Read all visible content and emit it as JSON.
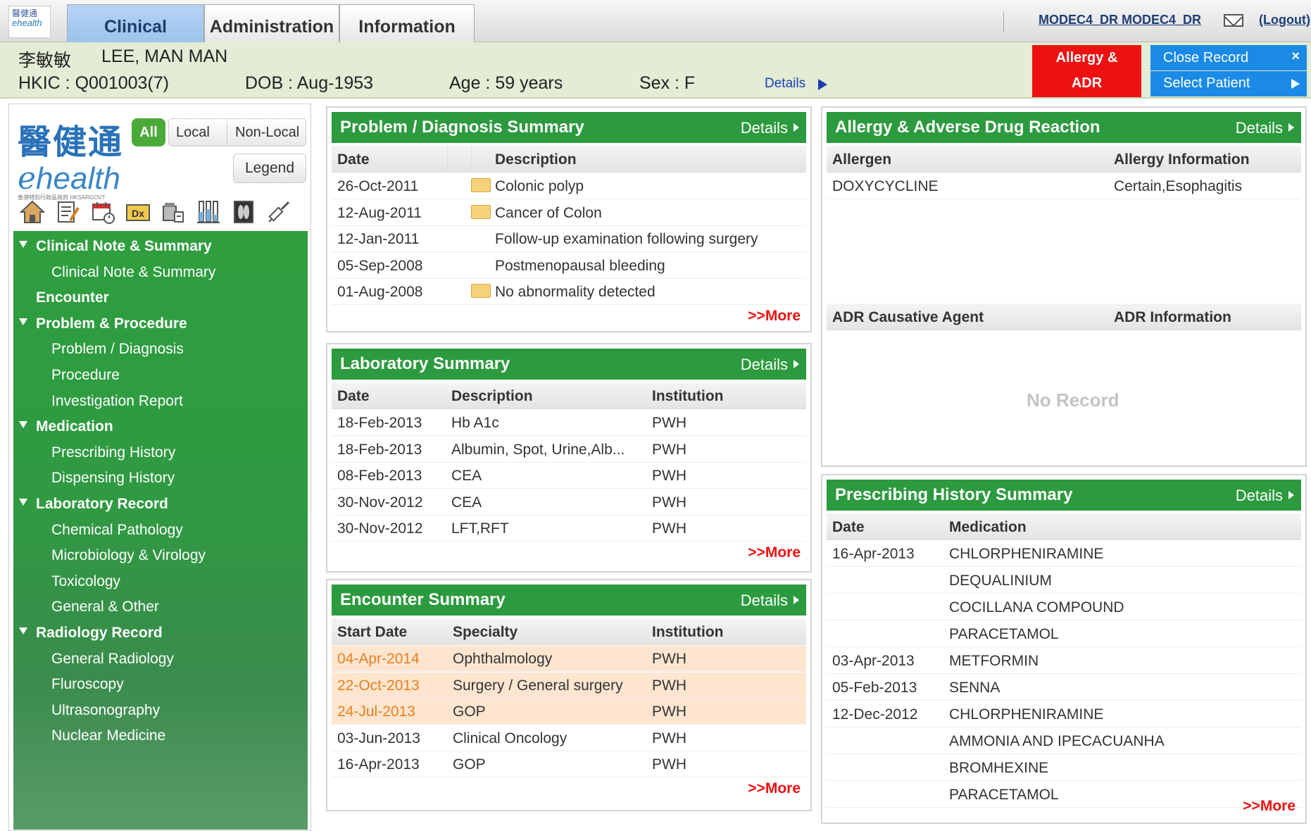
{
  "top": {
    "logo_lines": [
      "醫健通",
      "ehealth"
    ],
    "tabs": [
      "Clinical",
      "Administration",
      "Information"
    ],
    "user": "MODEC4_DR MODEC4_DR",
    "logout": "(Logout)"
  },
  "patient": {
    "chinese_name": "李敏敏",
    "english_name": "LEE, MAN MAN",
    "hkic": "HKIC : Q001003(7)",
    "dob": "DOB : Aug-1953",
    "age": "Age : 59 years",
    "sex": "Sex : F",
    "details": "Details",
    "allergy_btn": [
      "Allergy &",
      "ADR"
    ],
    "close_record": "Close Record",
    "close_x": "×",
    "select_patient": "Select Patient"
  },
  "leftnav": {
    "logo_cn": "醫健通",
    "logo_en": "health",
    "logo_e": "e",
    "logo_sub": "香港特別行政區政府 HKSARGOVT",
    "filters": {
      "all": "All",
      "local": "Local",
      "nonlocal": "Non-Local"
    },
    "legend": "Legend",
    "tree": [
      {
        "label": "Clinical Note & Summary",
        "parent": true,
        "expanded": true
      },
      {
        "label": "Clinical Note & Summary",
        "parent": false
      },
      {
        "label": "Encounter",
        "parent": true,
        "expanded": false
      },
      {
        "label": "Problem & Procedure",
        "parent": true,
        "expanded": true
      },
      {
        "label": "Problem / Diagnosis",
        "parent": false
      },
      {
        "label": "Procedure",
        "parent": false
      },
      {
        "label": "Investigation Report",
        "parent": false
      },
      {
        "label": "Medication",
        "parent": true,
        "expanded": true
      },
      {
        "label": "Prescribing History",
        "parent": false
      },
      {
        "label": "Dispensing History",
        "parent": false
      },
      {
        "label": "Laboratory Record",
        "parent": true,
        "expanded": true
      },
      {
        "label": "Chemical Pathology",
        "parent": false
      },
      {
        "label": "Microbiology & Virology",
        "parent": false
      },
      {
        "label": "Toxicology",
        "parent": false
      },
      {
        "label": "General & Other",
        "parent": false
      },
      {
        "label": "Radiology Record",
        "parent": true,
        "expanded": true
      },
      {
        "label": "General Radiology",
        "parent": false
      },
      {
        "label": "Fluroscopy",
        "parent": false
      },
      {
        "label": "Ultrasonography",
        "parent": false
      },
      {
        "label": "Nuclear Medicine",
        "parent": false
      }
    ]
  },
  "problem": {
    "title": "Problem / Diagnosis Summary",
    "details": "Details",
    "headers": [
      "Date",
      "Description"
    ],
    "rows": [
      {
        "date": "26-Oct-2011",
        "desc": "Colonic polyp",
        "folder": true
      },
      {
        "date": "12-Aug-2011",
        "desc": "Cancer of Colon",
        "folder": true
      },
      {
        "date": "12-Jan-2011",
        "desc": "Follow-up examination following surgery",
        "folder": false
      },
      {
        "date": "05-Sep-2008",
        "desc": "Postmenopausal bleeding",
        "folder": false
      },
      {
        "date": "01-Aug-2008",
        "desc": "No abnormality detected",
        "folder": true
      }
    ],
    "more": ">>More"
  },
  "lab": {
    "title": "Laboratory Summary",
    "details": "Details",
    "headers": [
      "Date",
      "Description",
      "Institution"
    ],
    "rows": [
      {
        "date": "18-Feb-2013",
        "desc": "Hb A1c",
        "inst": "PWH"
      },
      {
        "date": "18-Feb-2013",
        "desc": "Albumin, Spot, Urine,Alb...",
        "inst": "PWH"
      },
      {
        "date": "08-Feb-2013",
        "desc": "CEA",
        "inst": "PWH"
      },
      {
        "date": "30-Nov-2012",
        "desc": "CEA",
        "inst": "PWH"
      },
      {
        "date": "30-Nov-2012",
        "desc": "LFT,RFT",
        "inst": "PWH"
      }
    ],
    "more": ">>More"
  },
  "encounter": {
    "title": "Encounter Summary",
    "details": "Details",
    "headers": [
      "Start Date",
      "Specialty",
      "Institution"
    ],
    "rows": [
      {
        "date": "04-Apr-2014",
        "spec": "Ophthalmology",
        "inst": "PWH",
        "highlight": true
      },
      {
        "date": "22-Oct-2013",
        "spec": "Surgery / General surgery",
        "inst": "PWH",
        "highlight": true
      },
      {
        "date": "24-Jul-2013",
        "spec": "GOP",
        "inst": "PWH",
        "highlight": true
      },
      {
        "date": "03-Jun-2013",
        "spec": "Clinical Oncology",
        "inst": "PWH",
        "highlight": false
      },
      {
        "date": "16-Apr-2013",
        "spec": "GOP",
        "inst": "PWH",
        "highlight": false
      }
    ],
    "more": ">>More"
  },
  "allergy": {
    "title": "Allergy & Adverse Drug Reaction",
    "details": "Details",
    "headers": [
      "Allergen",
      "Allergy Information"
    ],
    "rows": [
      {
        "allergen": "DOXYCYCLINE",
        "info": "Certain,Esophagitis"
      }
    ],
    "adr_headers": [
      "ADR Causative Agent",
      "ADR Information"
    ],
    "no_record": "No Record"
  },
  "prescribing": {
    "title": "Prescribing History Summary",
    "details": "Details",
    "headers": [
      "Date",
      "Medication"
    ],
    "rows": [
      {
        "date": "16-Apr-2013",
        "med": "CHLORPHENIRAMINE"
      },
      {
        "date": "",
        "med": "DEQUALINIUM"
      },
      {
        "date": "",
        "med": "COCILLANA COMPOUND"
      },
      {
        "date": "",
        "med": "PARACETAMOL"
      },
      {
        "date": "03-Apr-2013",
        "med": "METFORMIN"
      },
      {
        "date": "05-Feb-2013",
        "med": "SENNA"
      },
      {
        "date": "12-Dec-2012",
        "med": "CHLORPHENIRAMINE"
      },
      {
        "date": "",
        "med": "AMMONIA AND IPECACUANHA"
      },
      {
        "date": "",
        "med": "BROMHEXINE"
      },
      {
        "date": "",
        "med": "PARACETAMOL"
      }
    ],
    "more": ">>More"
  },
  "toolbar_icons": [
    "home-icon",
    "clinical-note-icon",
    "calendar-icon",
    "dx-icon",
    "medication-icon",
    "lab-icon",
    "radiology-icon",
    "injection-icon"
  ]
}
